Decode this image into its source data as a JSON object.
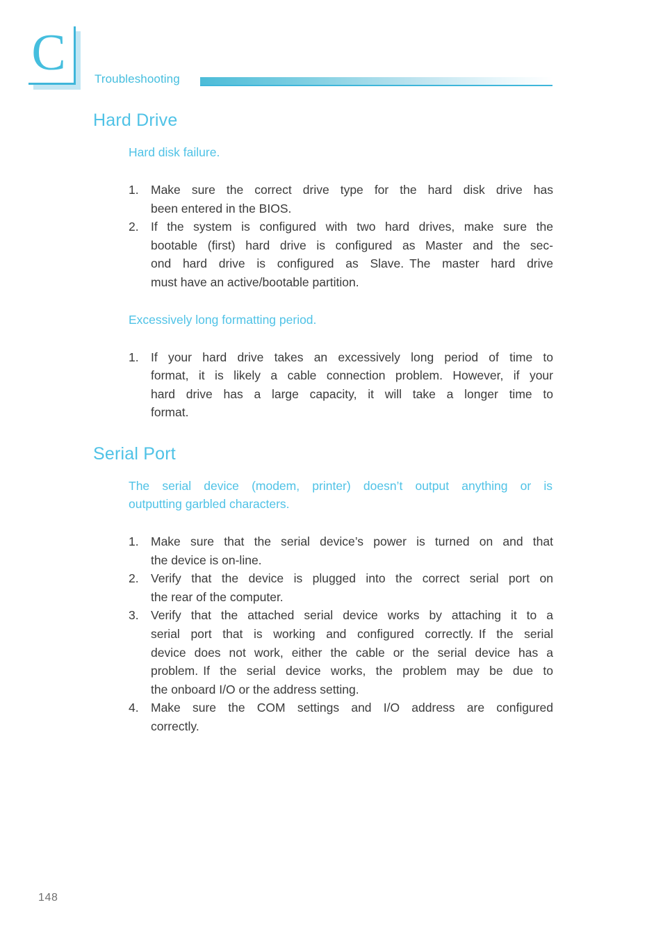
{
  "page": {
    "chapter_letter": "C",
    "running_head": "Troubleshooting",
    "folio": "148",
    "accent_color": "#4fc2e6",
    "rule_color": "#3fb6da",
    "shadow_color": "#c3e6f3",
    "body_color": "#3a3a3a"
  },
  "sections": [
    {
      "title": "Hard Drive",
      "blocks": [
        {
          "subtitle": "Hard disk failure.",
          "items": [
            {
              "num": "1.",
              "lines": [
                "Make  sure  the  correct  drive  type  for  the  hard  disk  drive  has",
                "been entered in the BIOS."
              ]
            },
            {
              "num": "2.",
              "lines": [
                "If the system is configured with two hard drives, make sure the",
                "bootable (first) hard drive is configured as Master and the sec-",
                "ond  hard  drive  is  configured  as  Slave. The  master  hard  drive",
                "must have an active/bootable partition."
              ]
            }
          ]
        },
        {
          "subtitle": "Excessively long formatting period.",
          "items": [
            {
              "num": "1.",
              "lines": [
                "If  your  hard  drive  takes  an  excessively  long  period  of  time  to",
                "format, it is likely a cable connection problem. However, if your",
                "hard  drive  has  a  large  capacity,  it  will  take  a  longer  time  to",
                "format."
              ]
            }
          ]
        }
      ]
    },
    {
      "title": "Serial Port",
      "blocks": [
        {
          "subtitle_line1": "The  serial  device  (modem, printer)  doesn’t  output  anything  or  is",
          "subtitle_line2": "outputting garbled characters.",
          "items": [
            {
              "num": "1.",
              "lines": [
                "Make  sure  that  the  serial  device’s  power  is  turned  on  and  that",
                "the device is on-line."
              ]
            },
            {
              "num": "2.",
              "lines": [
                "Verify  that  the  device  is  plugged  into  the  correct  serial  port  on",
                "the rear of the computer."
              ]
            },
            {
              "num": "3.",
              "lines": [
                "Verify  that  the  attached  serial  device  works  by  attaching  it  to  a",
                "serial  port  that  is  working  and  configured  correctly. If  the  serial",
                "device does not work, either the cable or the serial device has a",
                "problem. If  the  serial  device  works,  the  problem  may  be  due  to",
                "the onboard I/O or the address setting."
              ]
            },
            {
              "num": "4.",
              "lines": [
                "Make  sure  the  COM  settings  and  I/O  address  are  configured",
                "correctly."
              ]
            }
          ]
        }
      ]
    }
  ]
}
